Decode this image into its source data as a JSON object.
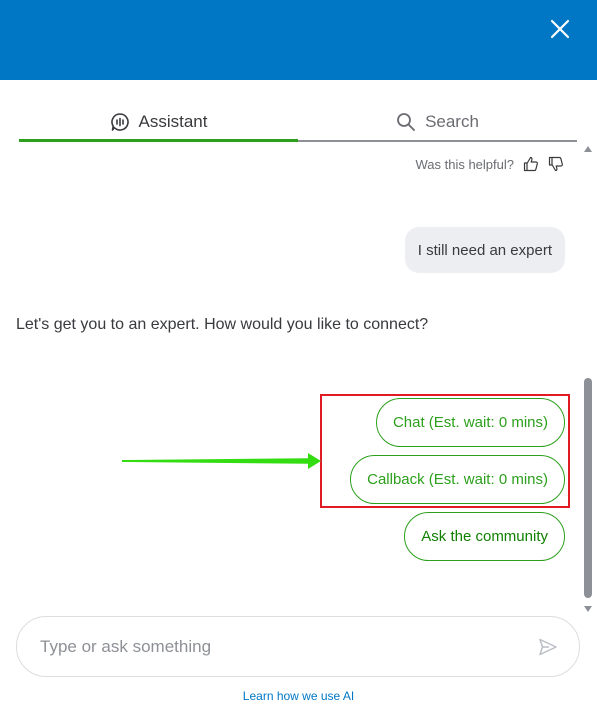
{
  "header": {
    "close_icon": "close-icon",
    "background": "#0077c5"
  },
  "tabs": [
    {
      "label": "Assistant",
      "icon": "chat-bubble-icon",
      "active": true
    },
    {
      "label": "Search",
      "icon": "search-icon",
      "active": false
    }
  ],
  "feedback": {
    "label": "Was this helpful?",
    "thumbs_up_icon": "thumbs-up-icon",
    "thumbs_down_icon": "thumbs-down-icon"
  },
  "messages": {
    "user": "I still need an expert",
    "bot": "Let's get you to an expert. How would you like to connect?"
  },
  "options": [
    {
      "label": "Chat (Est. wait: 0 mins)"
    },
    {
      "label": "Callback (Est. wait: 0 mins)"
    },
    {
      "label": "Ask the community"
    }
  ],
  "composer": {
    "placeholder": "Type or ask something",
    "send_icon": "send-icon"
  },
  "footer": {
    "link": "Learn how we use AI"
  },
  "colors": {
    "accent_green": "#2ca01c",
    "brand_blue": "#0077c5",
    "annotation_red": "#e01b24",
    "annotation_arrow": "#33dd11"
  }
}
